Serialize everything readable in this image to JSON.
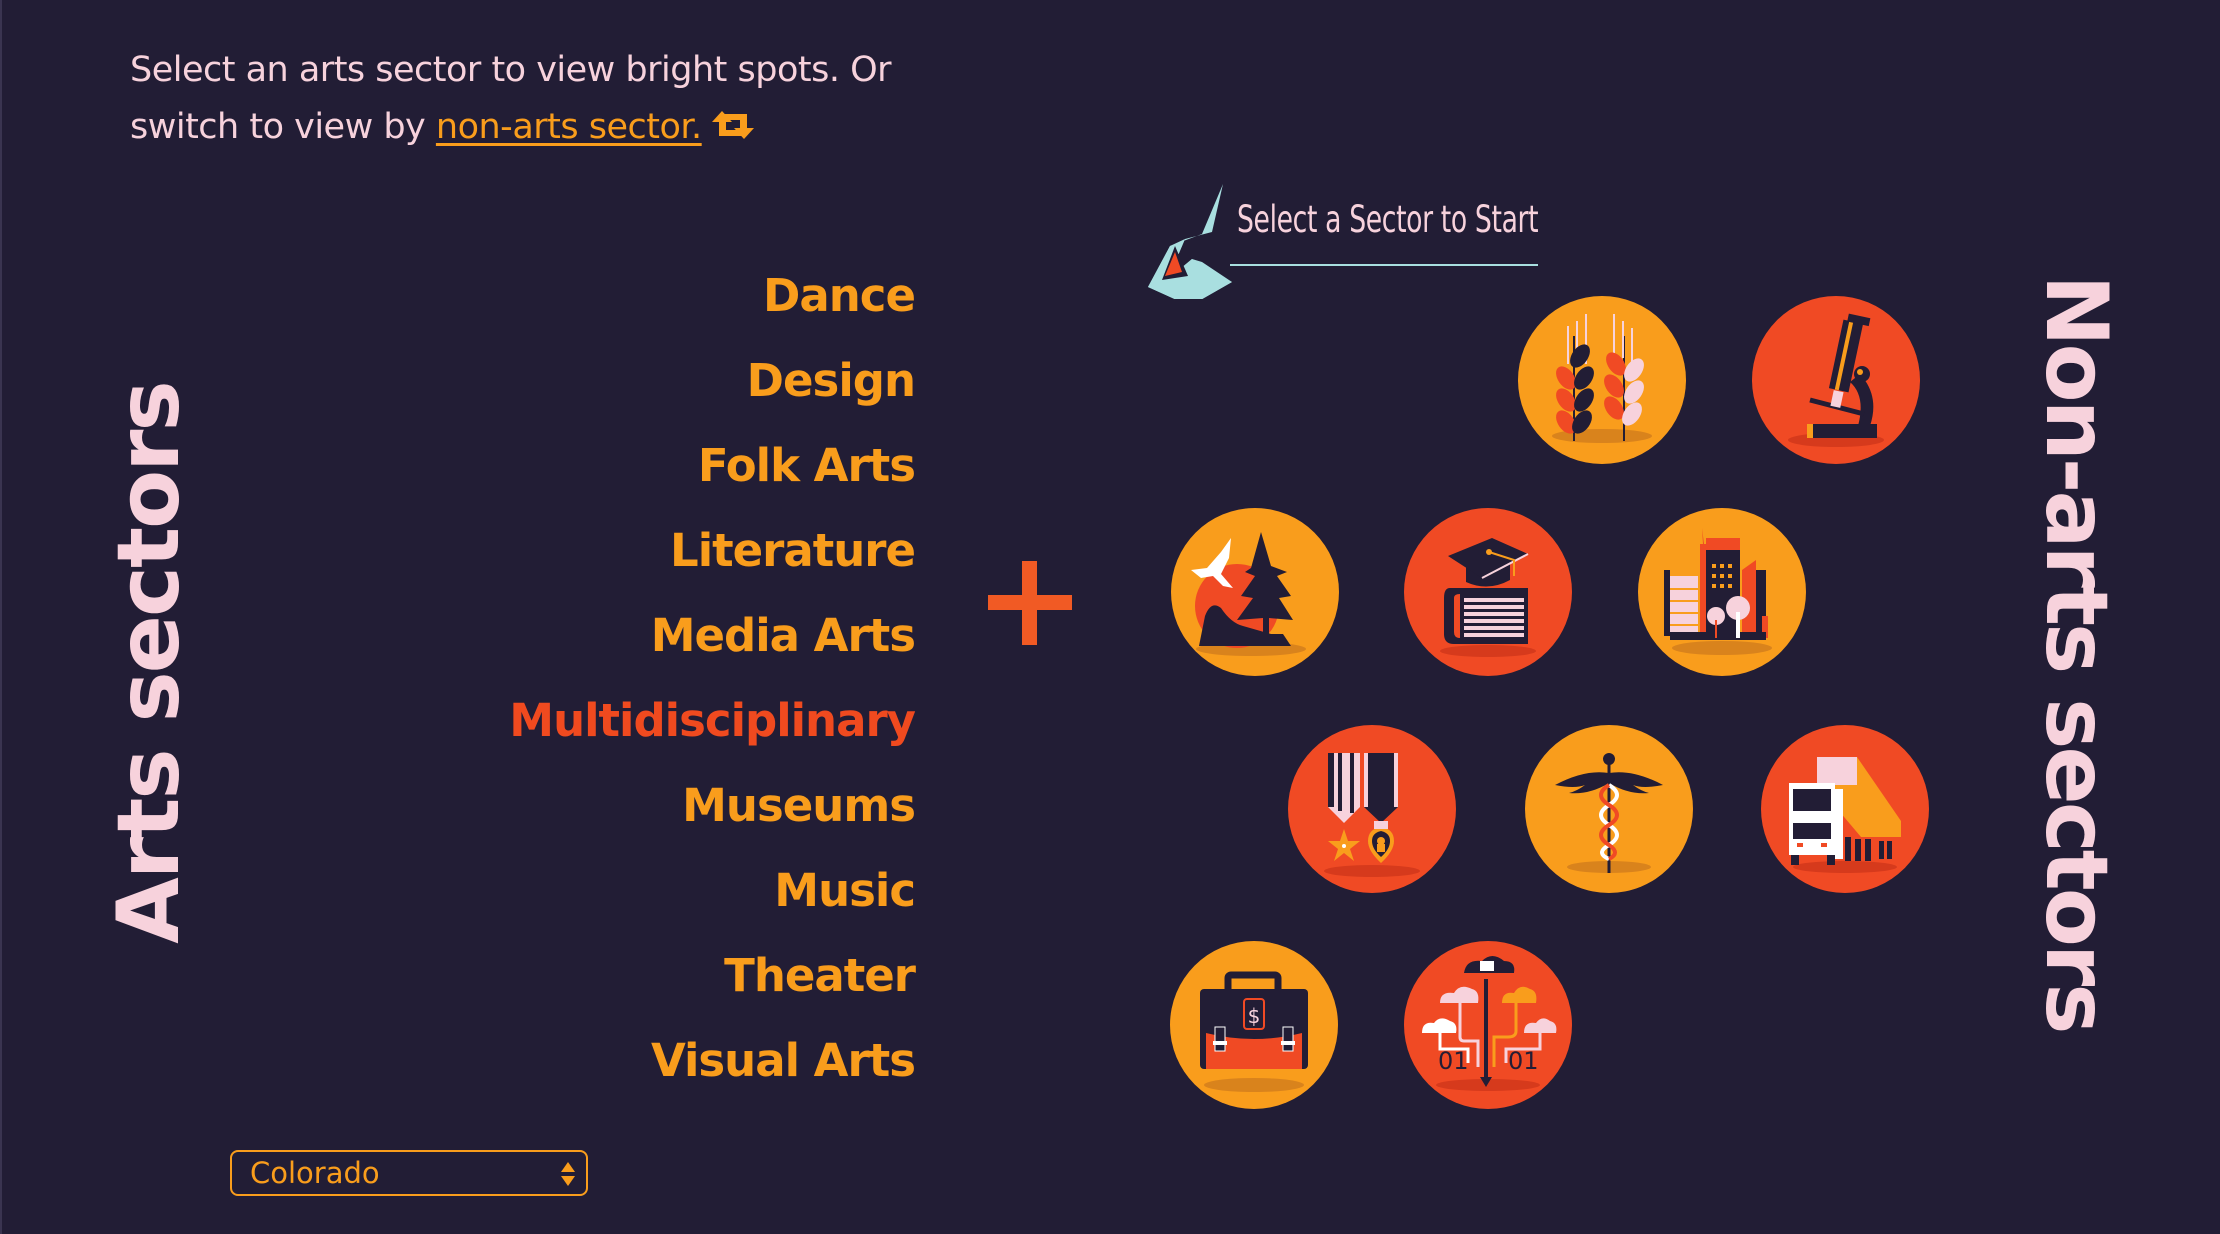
{
  "intro": {
    "text": "Select an arts sector to view bright spots. Or switch to view by ",
    "link_label": "non-arts sector.",
    "swap_icon": "swap-arrows-icon"
  },
  "arts": {
    "heading": "Arts sectors",
    "selected": "Multidisciplinary",
    "items": [
      {
        "label": "Dance"
      },
      {
        "label": "Design"
      },
      {
        "label": "Folk Arts"
      },
      {
        "label": "Literature"
      },
      {
        "label": "Media Arts"
      },
      {
        "label": "Multidisciplinary"
      },
      {
        "label": "Museums"
      },
      {
        "label": "Music"
      },
      {
        "label": "Theater"
      },
      {
        "label": "Visual Arts"
      }
    ]
  },
  "connector": {
    "icon": "plus-icon"
  },
  "prompt": {
    "label": "Select a Sector to Start",
    "icon": "arrow-banner-icon"
  },
  "nonarts": {
    "heading": "Non-arts sectors",
    "items": [
      {
        "name": "agriculture",
        "icon": "wheat-icon",
        "color": "orange"
      },
      {
        "name": "science",
        "icon": "microscope-icon",
        "color": "red"
      },
      {
        "name": "environment",
        "icon": "nature-landscape-icon",
        "color": "orange"
      },
      {
        "name": "education",
        "icon": "graduation-book-icon",
        "color": "red"
      },
      {
        "name": "community-development",
        "icon": "city-buildings-icon",
        "color": "orange"
      },
      {
        "name": "military",
        "icon": "medals-icon",
        "color": "red"
      },
      {
        "name": "health",
        "icon": "caduceus-icon",
        "color": "orange"
      },
      {
        "name": "transportation",
        "icon": "truck-icon",
        "color": "red"
      },
      {
        "name": "economic-development",
        "icon": "briefcase-dollar-icon",
        "color": "orange"
      },
      {
        "name": "technology",
        "icon": "cloud-data-icon",
        "color": "red"
      }
    ]
  },
  "state_select": {
    "value": "Colorado"
  },
  "colors": {
    "background": "#221d35",
    "orange": "#f99d1c",
    "red": "#f04a24",
    "pink": "#f7d2dc",
    "teal": "#a9dfe0"
  }
}
